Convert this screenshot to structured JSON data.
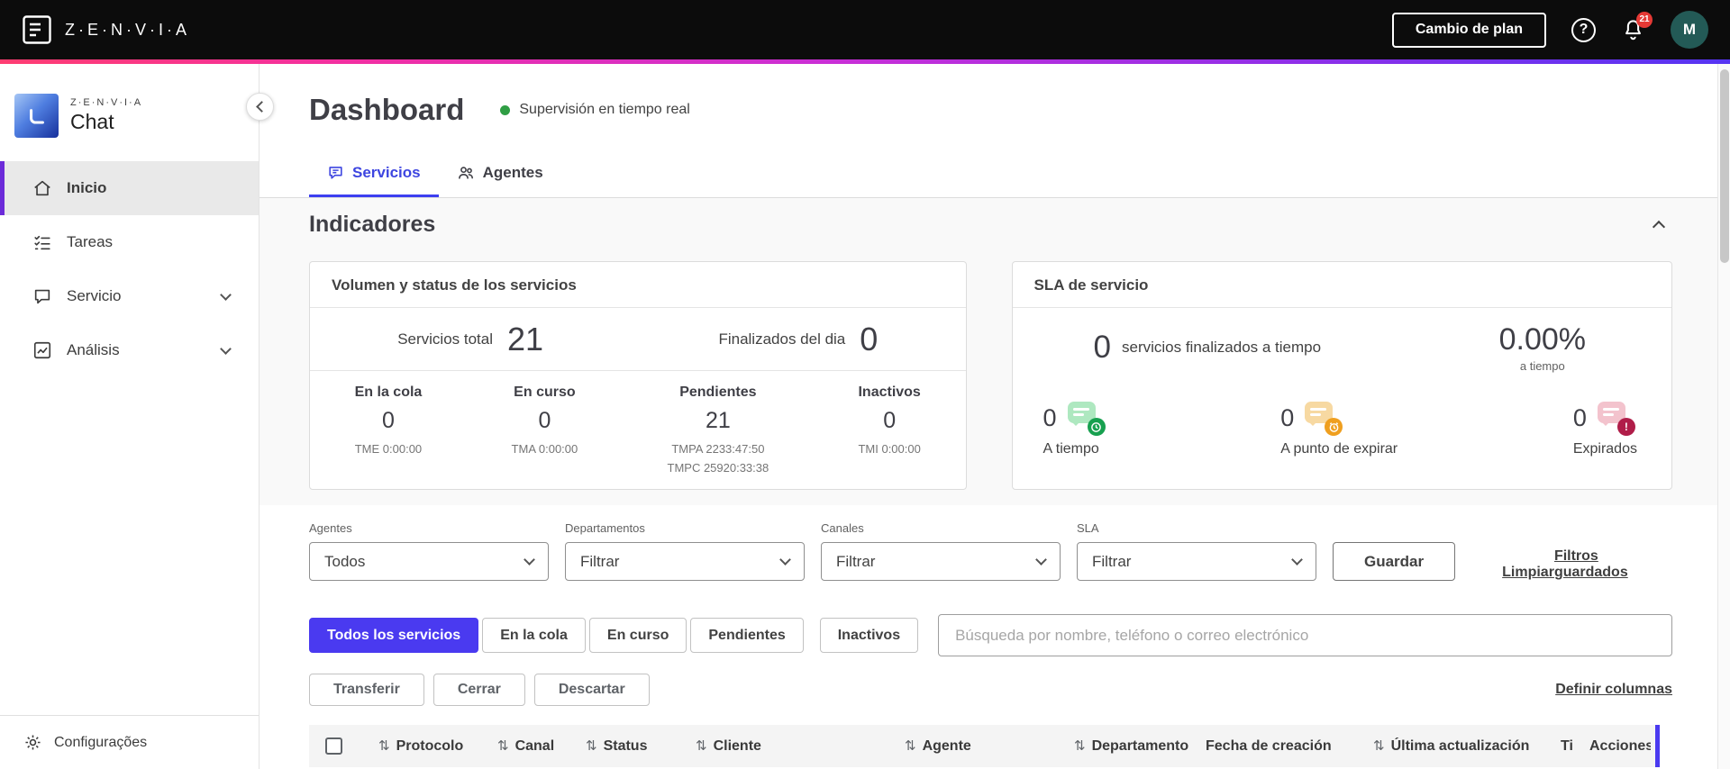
{
  "topbar": {
    "brand": "Z·E·N·V·I·A",
    "change_plan_label": "Cambio de plan",
    "notification_count": "21",
    "avatar_initial": "M"
  },
  "sidebar": {
    "logo_brand": "Z·E·N·V·I·A",
    "logo_product": "Chat",
    "items": [
      {
        "label": "Inicio",
        "icon": "home-icon"
      },
      {
        "label": "Tareas",
        "icon": "tasks-icon"
      },
      {
        "label": "Servicio",
        "icon": "chat-icon"
      },
      {
        "label": "Análisis",
        "icon": "chart-icon"
      }
    ],
    "footer_label": "Configurações"
  },
  "page": {
    "title": "Dashboard",
    "status_label": "Supervisión en tiempo real"
  },
  "tabs": [
    {
      "label": "Servicios"
    },
    {
      "label": "Agentes"
    }
  ],
  "indicators": {
    "section_title": "Indicadores",
    "volume_card": {
      "title": "Volumen y status de los servicios",
      "total_label": "Servicios total",
      "total_value": "21",
      "finished_label": "Finalizados del dia",
      "finished_value": "0",
      "stats": [
        {
          "label": "En la cola",
          "value": "0",
          "sub": "TME 0:00:00"
        },
        {
          "label": "En curso",
          "value": "0",
          "sub": "TMA 0:00:00"
        },
        {
          "label": "Pendientes",
          "value": "21",
          "sub": "TMPA 2233:47:50",
          "sub2": "TMPC 25920:33:38"
        },
        {
          "label": "Inactivos",
          "value": "0",
          "sub": "TMI 0:00:00"
        }
      ]
    },
    "sla_card": {
      "title": "SLA de servicio",
      "finished_value": "0",
      "finished_label": "servicios finalizados a tiempo",
      "percent_value": "0.00%",
      "percent_label": "a tiempo",
      "items": [
        {
          "value": "0",
          "label": "A tiempo",
          "icon": "chat-ontime-icon"
        },
        {
          "value": "0",
          "label": "A punto de expirar",
          "icon": "chat-expiring-icon"
        },
        {
          "value": "0",
          "label": "Expirados",
          "icon": "chat-expired-icon"
        }
      ]
    }
  },
  "filters": {
    "fields": [
      {
        "label": "Agentes",
        "value": "Todos"
      },
      {
        "label": "Departamentos",
        "value": "Filtrar"
      },
      {
        "label": "Canales",
        "value": "Filtrar"
      },
      {
        "label": "SLA",
        "value": "Filtrar"
      }
    ],
    "save_label": "Guardar",
    "clear_label": "Limpiar",
    "saved_label": "Filtros guardados"
  },
  "service_filters": [
    {
      "label": "Todos los servicios"
    },
    {
      "label": "En la cola"
    },
    {
      "label": "En curso"
    },
    {
      "label": "Pendientes"
    },
    {
      "label": "Inactivos"
    }
  ],
  "search": {
    "placeholder": "Búsqueda por nombre, teléfono o correo electrónico"
  },
  "bulk_actions": {
    "transfer": "Transferir",
    "close": "Cerrar",
    "discard": "Descartar",
    "define_columns": "Definir columnas"
  },
  "table": {
    "columns": [
      {
        "label": "Protocolo",
        "sortable": true
      },
      {
        "label": "Canal",
        "sortable": true
      },
      {
        "label": "Status",
        "sortable": true
      },
      {
        "label": "Cliente",
        "sortable": true
      },
      {
        "label": "Agente",
        "sortable": true
      },
      {
        "label": "Departamento",
        "sortable": true
      },
      {
        "label": "Fecha de creación",
        "sortable": false
      },
      {
        "label": "Última actualización",
        "sortable": true
      },
      {
        "label": "Ti",
        "sortable": false
      },
      {
        "label": "Acciones",
        "sortable": false
      }
    ]
  },
  "colors": {
    "accent": "#4a3af0",
    "tab_active": "#3d45e0",
    "sidebar_active_border": "#6c2bd9",
    "status_green": "#2f9e44",
    "badge_red": "#e53935",
    "avatar_bg": "#235a56",
    "topbar_bg": "#0c0c0c"
  }
}
